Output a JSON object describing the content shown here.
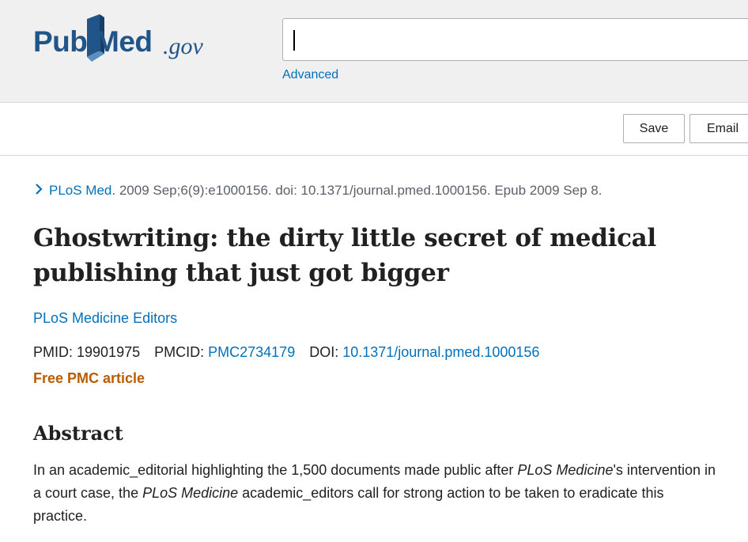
{
  "header": {
    "logo": {
      "pub": "Pub",
      "med": "Med",
      "gov": ".gov"
    },
    "search": {
      "value": "",
      "placeholder": ""
    },
    "advanced_label": "Advanced"
  },
  "actions": {
    "save_label": "Save",
    "email_label": "Email"
  },
  "article": {
    "citation": {
      "journal": "PLoS Med.",
      "details": " 2009 Sep;6(9):e1000156. doi: 10.1371/journal.pmed.1000156. Epub 2009 Sep 8."
    },
    "title": "Ghostwriting: the dirty little secret of medical publishing that just got bigger",
    "author": "PLoS Medicine Editors",
    "ids": {
      "pmid_label": "PMID: ",
      "pmid": "19901975",
      "pmcid_label": "PMCID: ",
      "pmcid": "PMC2734179",
      "doi_label": "DOI: ",
      "doi": "10.1371/journal.pmed.1000156"
    },
    "free_pmc": "Free PMC article",
    "abstract": {
      "heading": "Abstract",
      "part1": "In an academic_editorial highlighting the 1,500 documents made public after ",
      "em1": "PLoS Medicine",
      "part2": "'s intervention in a court case, the ",
      "em2": "PLoS Medicine",
      "part3": " academic_editors call for strong action to be taken to eradicate this practice."
    }
  },
  "colors": {
    "brand": "#20558a",
    "link": "#0071bc",
    "free_pmc": "#b85c00",
    "header_bg": "#f0f0f0"
  }
}
